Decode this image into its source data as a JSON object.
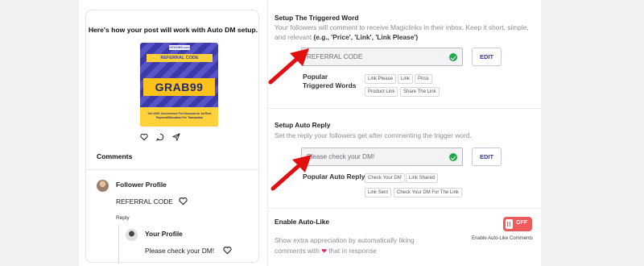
{
  "preview": {
    "title": "Here's how your post will work with Auto DM setup.",
    "post_image": {
      "brand": "HOUSING.com",
      "ribbon": "REFERRAL CODE",
      "code": "GRAB99",
      "fine_print": "Get 100% Convenience Fee Discount on 1st Rent Payment/Education Fee Transaction"
    },
    "actions": [
      "heart-icon",
      "comment-icon",
      "send-icon"
    ],
    "comments_title": "Comments",
    "comments": [
      {
        "author": "Follower Profile",
        "text": "REFERRAL CODE",
        "reply_label": "Reply"
      },
      {
        "author": "Your Profile",
        "text": "Please check your DM!"
      }
    ]
  },
  "trigger": {
    "title": "Setup The Triggered Word",
    "desc": "Your followers will comment to receive Magiclinks in their inbox. Keep it short, simple, and relevant",
    "desc_examples": "(e.g., 'Price', 'Link', 'Link Please')",
    "value": "REFERRAL CODE",
    "edit_label": "EDIT",
    "popular_label": "Popular Triggered Words",
    "chips": [
      "Link Please",
      "Link",
      "Price",
      "Product Link",
      "Share The Link"
    ]
  },
  "reply": {
    "title": "Setup Auto Reply",
    "desc": "Set the reply your followers get after commenting the trigger word.",
    "value": "Please check your DM!",
    "edit_label": "EDIT",
    "popular_label": "Popular Auto Reply",
    "chips": [
      "Check Your DM",
      "Link Shared",
      "Link Sent",
      "Check Your DM For The Link"
    ]
  },
  "autolike": {
    "title": "Enable Auto-Like",
    "desc_line1": "Show extra appreciation by automatically liking",
    "desc_line2_a": "comments with",
    "desc_line2_b": "that in response",
    "toggle_state": "OFF",
    "toggle_caption": "Enable Auto-Like Comments"
  },
  "colors": {
    "accent": "#3b3a9e",
    "toggle_off": "#ef5a5a",
    "check": "#1fa84a",
    "arrow": "#e01010"
  }
}
